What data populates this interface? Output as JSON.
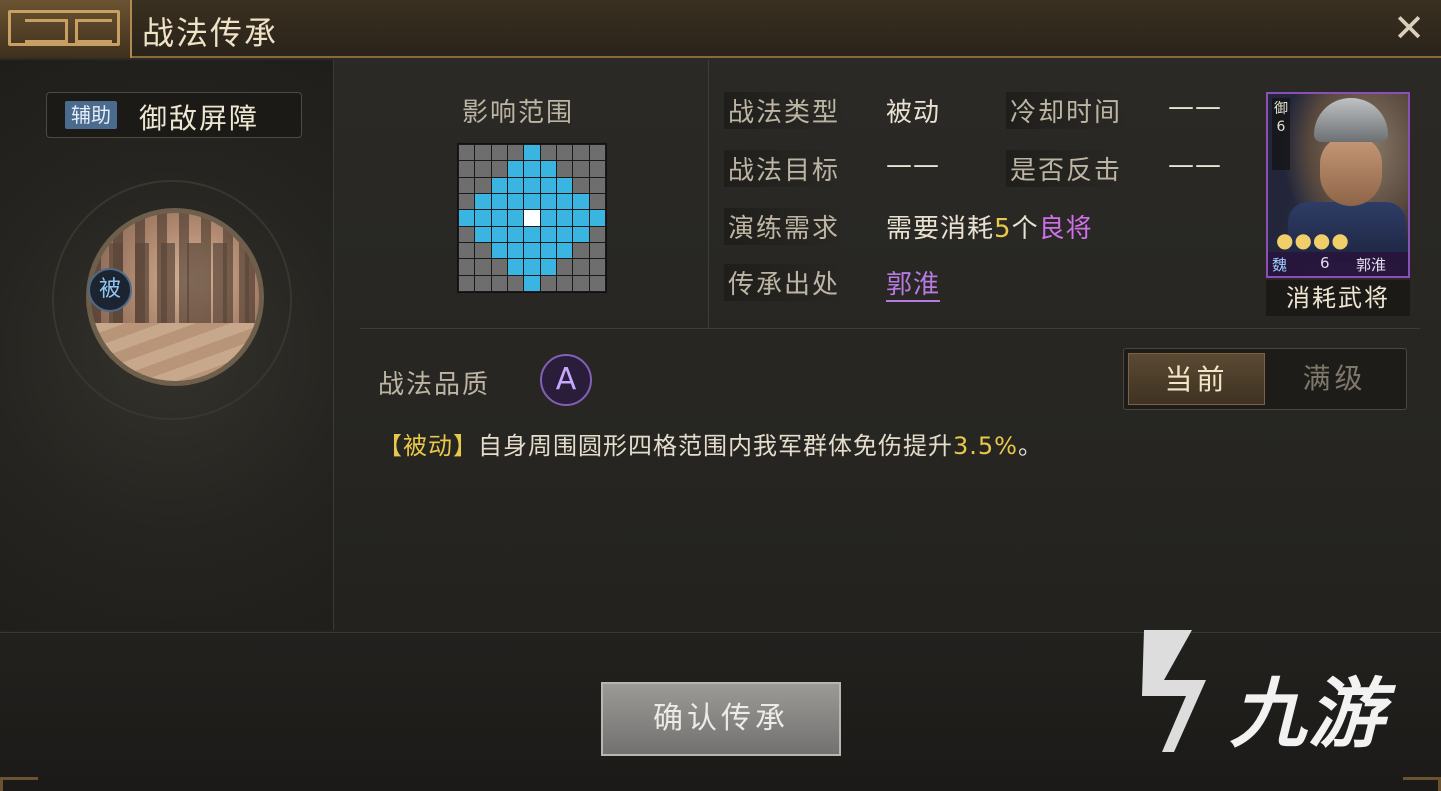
{
  "window": {
    "title": "战法传承",
    "close_glyph": "✕"
  },
  "skill": {
    "tag": "辅助",
    "name": "御敌屏障",
    "passive_badge": "被"
  },
  "range": {
    "label": "影响范围",
    "grid_size": 9,
    "active_cells": [
      [
        0,
        4
      ],
      [
        1,
        3
      ],
      [
        1,
        4
      ],
      [
        1,
        5
      ],
      [
        2,
        2
      ],
      [
        2,
        3
      ],
      [
        2,
        4
      ],
      [
        2,
        5
      ],
      [
        2,
        6
      ],
      [
        3,
        1
      ],
      [
        3,
        2
      ],
      [
        3,
        3
      ],
      [
        3,
        4
      ],
      [
        3,
        5
      ],
      [
        3,
        6
      ],
      [
        3,
        7
      ],
      [
        4,
        0
      ],
      [
        4,
        1
      ],
      [
        4,
        2
      ],
      [
        4,
        3
      ],
      [
        4,
        5
      ],
      [
        4,
        6
      ],
      [
        4,
        7
      ],
      [
        4,
        8
      ],
      [
        5,
        1
      ],
      [
        5,
        2
      ],
      [
        5,
        3
      ],
      [
        5,
        4
      ],
      [
        5,
        5
      ],
      [
        5,
        6
      ],
      [
        5,
        7
      ],
      [
        6,
        2
      ],
      [
        6,
        3
      ],
      [
        6,
        4
      ],
      [
        6,
        5
      ],
      [
        6,
        6
      ],
      [
        7,
        3
      ],
      [
        7,
        4
      ],
      [
        7,
        5
      ],
      [
        8,
        4
      ]
    ],
    "center_cell": [
      4,
      4
    ],
    "active_color": "#3ab4e0"
  },
  "attributes": {
    "type_label": "战法类型",
    "type_value": "被动",
    "cooldown_label": "冷却时间",
    "cooldown_value": "——",
    "target_label": "战法目标",
    "target_value": "——",
    "counter_label": "是否反击",
    "counter_value": "——",
    "drill_label": "演练需求",
    "drill_prefix": "需要消耗",
    "drill_count": "5",
    "drill_unit": "个",
    "drill_grade": "良将",
    "origin_label": "传承出处",
    "origin_value": "郭淮"
  },
  "general_card": {
    "troop_type": "御",
    "troop_level": "6",
    "stars": "●●●●",
    "faction": "魏",
    "cost": "6",
    "name": "郭淮",
    "consume_label": "消耗武将"
  },
  "quality": {
    "label": "战法品质",
    "grade": "A"
  },
  "toggle": {
    "current": "当前",
    "max": "满级"
  },
  "description": {
    "tag": "【被动】",
    "text": "自身周围圆形四格范围内我军群体免伤提升",
    "value": "3.5%",
    "suffix": "。"
  },
  "footer": {
    "confirm": "确认传承",
    "watermark": "九游"
  }
}
